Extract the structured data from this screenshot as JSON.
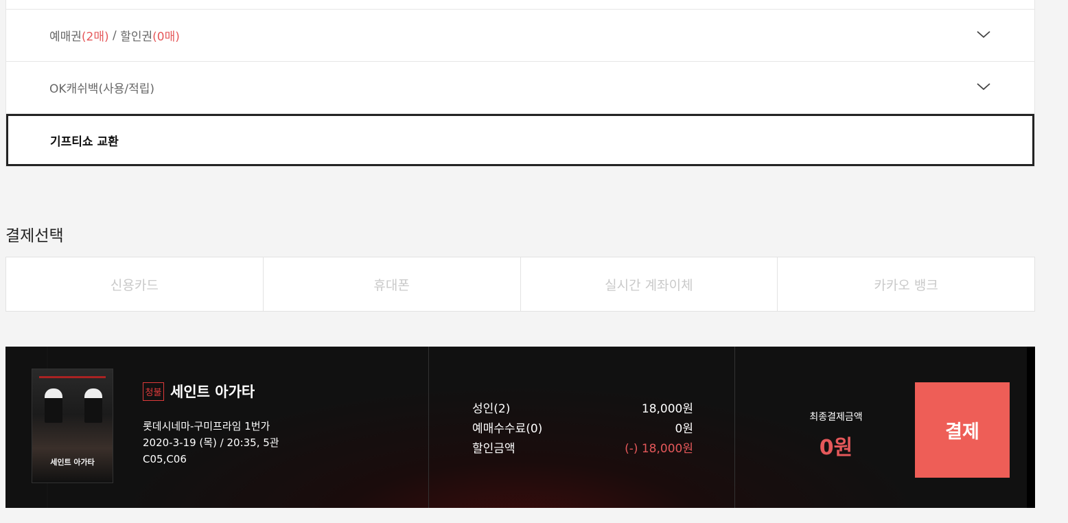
{
  "discounts": {
    "ticket_label": "예매권",
    "ticket_count": "(2매)",
    "separator": " / ",
    "coupon_label": "할인권",
    "coupon_count": "(0매)",
    "okcashbag_label": "OK캐쉬백(사용/적립)",
    "gifticon_label": "기프티쇼 교환"
  },
  "payment": {
    "title": "결제선택",
    "methods": [
      "신용카드",
      "휴대폰",
      "실시간 계좌이체",
      "카카오 뱅크"
    ]
  },
  "summary": {
    "rating": "청불",
    "movie_title": "세인트 아가타",
    "theater": "롯데시네마-구미프라임 1번가",
    "datetime": "2020-3-19 (목) / 20:35, 5관",
    "seats": "C05,C06",
    "poster_title": "세인트 아가타",
    "prices": [
      {
        "label": "성인(2)",
        "value": "18,000원"
      },
      {
        "label": "예매수수료(0)",
        "value": "0원"
      },
      {
        "label": "할인금액",
        "value": "(-) 18,000원"
      }
    ],
    "final_label": "최종결제금액",
    "final_amount": "0원",
    "pay_button": "결제"
  },
  "colors": {
    "accent": "#e5585a",
    "pay_button": "#ee5e57",
    "tab_text_disabled": "#c9c9c9"
  },
  "icons": {
    "expand": "chevron-down-icon"
  }
}
